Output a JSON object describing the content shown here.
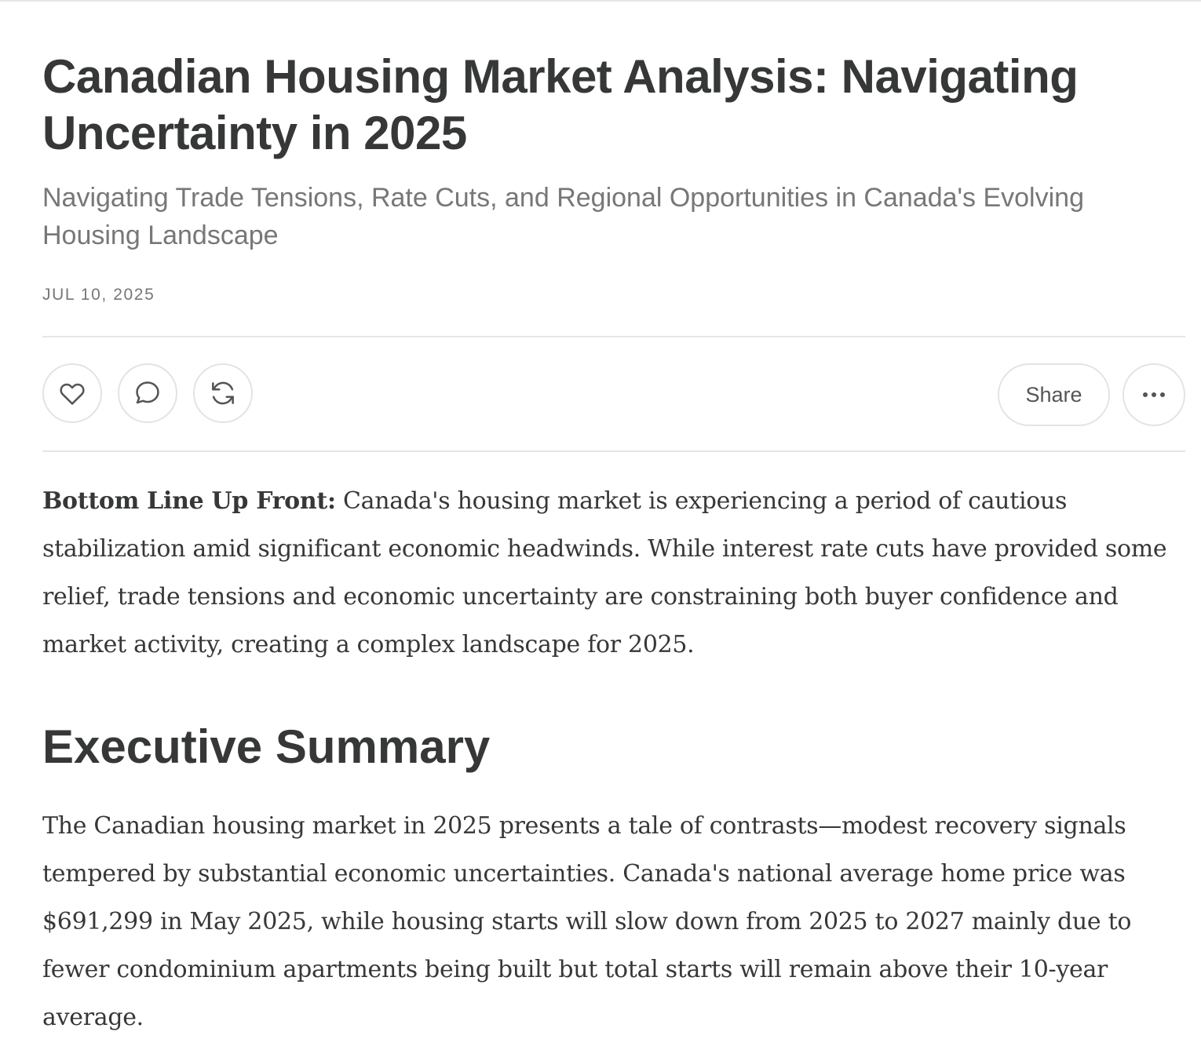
{
  "post": {
    "title": "Canadian Housing Market Analysis: Navigating Uncertainty in 2025",
    "subtitle": "Navigating Trade Tensions, Rate Cuts, and Regional Opportunities in Canada's Evolving Housing Landscape",
    "date": "JUL 10, 2025"
  },
  "actions": {
    "like_icon": "heart-icon",
    "comment_icon": "speech-bubble-icon",
    "restack_icon": "restack-arrows-icon",
    "share_label": "Share",
    "more_icon": "ellipsis-icon"
  },
  "content": {
    "bluf_label": "Bottom Line Up Front:",
    "bluf_text": " Canada's housing market is experiencing a period of cautious stabilization amid significant economic headwinds. While interest rate cuts have provided some relief, trade tensions and economic uncertainty are constraining both buyer confidence and market activity, creating a complex landscape for 2025.",
    "section_heading": "Executive Summary",
    "executive_summary": "The Canadian housing market in 2025 presents a tale of contrasts—modest recovery signals tempered by substantial economic uncertainties. Canada's national average home price was $691,299 in May 2025, while housing starts will slow down from 2025 to 2027 mainly due to fewer condominium apartments being built but total starts will remain above their 10-year average."
  },
  "colors": {
    "text": "#363737",
    "muted": "#777777",
    "border": "#e3e3e3"
  }
}
